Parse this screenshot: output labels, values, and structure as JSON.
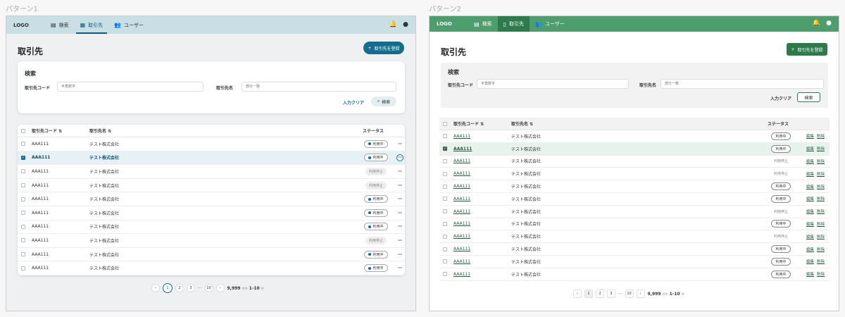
{
  "patterns": [
    {
      "label": "パターン1",
      "logo": "LOGO",
      "nav": [
        {
          "label": "検索",
          "icon": "document-icon"
        },
        {
          "label": "取引先",
          "icon": "building-icon"
        },
        {
          "label": "ユーザー",
          "icon": "users-icon"
        }
      ],
      "page_title": "取引先",
      "register_button": "取引先を登録",
      "search": {
        "title": "検索",
        "code_label": "取引先コード",
        "code_placeholder": "半角数字",
        "name_label": "取引先名",
        "name_placeholder": "部分一致",
        "clear": "入力クリア",
        "submit": "検索"
      },
      "table": {
        "headers": [
          "取引先コード",
          "取引先名",
          "ステータス"
        ],
        "rows": [
          {
            "code": "AAA111",
            "name": "テスト株式会社",
            "status": "利用中",
            "active": true,
            "selected": false
          },
          {
            "code": "AAA111",
            "name": "テスト株式会社",
            "status": "利用中",
            "active": true,
            "selected": true
          },
          {
            "code": "AAA111",
            "name": "テスト株式会社",
            "status": "利用停止",
            "active": false,
            "selected": false
          },
          {
            "code": "AAA111",
            "name": "テスト株式会社",
            "status": "利用停止",
            "active": false,
            "selected": false
          },
          {
            "code": "AAA111",
            "name": "テスト株式会社",
            "status": "利用中",
            "active": true,
            "selected": false
          },
          {
            "code": "AAA111",
            "name": "テスト株式会社",
            "status": "利用中",
            "active": true,
            "selected": false
          },
          {
            "code": "AAA111",
            "name": "テスト株式会社",
            "status": "利用中",
            "active": true,
            "selected": false
          },
          {
            "code": "AAA111",
            "name": "テスト株式会社",
            "status": "利用停止",
            "active": false,
            "selected": false
          },
          {
            "code": "AAA111",
            "name": "テスト株式会社",
            "status": "利用中",
            "active": true,
            "selected": false
          },
          {
            "code": "AAA111",
            "name": "テスト株式会社",
            "status": "利用中",
            "active": true,
            "selected": false
          }
        ]
      },
      "pager": {
        "pages": [
          "1",
          "2",
          "3"
        ],
        "ellipsis": "⋯",
        "last": "10",
        "total": "9,999",
        "total_unit": "件中",
        "range": "1-10",
        "range_unit": "件"
      }
    },
    {
      "label": "パターン2",
      "logo": "LOGO",
      "nav": [
        {
          "label": "検索",
          "icon": "document-icon"
        },
        {
          "label": "取引先",
          "icon": "building-icon"
        },
        {
          "label": "ユーザー",
          "icon": "users-icon"
        }
      ],
      "page_title": "取引先",
      "register_button": "取引先を登録",
      "search": {
        "title": "検索",
        "code_label": "取引先コード",
        "code_placeholder": "半角数字",
        "name_label": "取引先名",
        "name_placeholder": "部分一致",
        "clear": "入力クリア",
        "submit": "検索"
      },
      "table": {
        "headers": [
          "取引先コード",
          "取引先名",
          "ステータス"
        ],
        "edit": "編集",
        "delete": "削除",
        "rows": [
          {
            "code": "AAA111",
            "name": "テスト株式会社",
            "status": "利用中",
            "active": true,
            "selected": false
          },
          {
            "code": "AAA111",
            "name": "テスト株式会社",
            "status": "利用中",
            "active": true,
            "selected": true
          },
          {
            "code": "AAA111",
            "name": "テスト株式会社",
            "status": "利用停止",
            "active": false,
            "selected": false
          },
          {
            "code": "AAA111",
            "name": "テスト株式会社",
            "status": "利用停止",
            "active": false,
            "selected": false
          },
          {
            "code": "AAA111",
            "name": "テスト株式会社",
            "status": "利用中",
            "active": true,
            "selected": false
          },
          {
            "code": "AAA111",
            "name": "テスト株式会社",
            "status": "利用中",
            "active": true,
            "selected": false
          },
          {
            "code": "AAA111",
            "name": "テスト株式会社",
            "status": "利用停止",
            "active": false,
            "selected": false
          },
          {
            "code": "AAA111",
            "name": "テスト株式会社",
            "status": "利用中",
            "active": true,
            "selected": false
          },
          {
            "code": "AAA111",
            "name": "テスト株式会社",
            "status": "利用停止",
            "active": false,
            "selected": false
          },
          {
            "code": "AAA111",
            "name": "テスト株式会社",
            "status": "利用中",
            "active": true,
            "selected": false
          },
          {
            "code": "AAA111",
            "name": "テスト株式会社",
            "status": "利用中",
            "active": true,
            "selected": false
          },
          {
            "code": "AAA111",
            "name": "テスト株式会社",
            "status": "利用中",
            "active": true,
            "selected": false
          }
        ]
      },
      "pager": {
        "pages": [
          "1",
          "2",
          "3"
        ],
        "ellipsis": "⋯",
        "last": "10",
        "total": "9,999",
        "total_unit": "件中",
        "range": "1-10",
        "range_unit": "件"
      }
    }
  ],
  "colors": {
    "pattern1_header": "#c8dfe6",
    "pattern1_accent": "#136d8d",
    "pattern2_header": "#4e9d6d",
    "pattern2_accent": "#2f7a4b"
  }
}
